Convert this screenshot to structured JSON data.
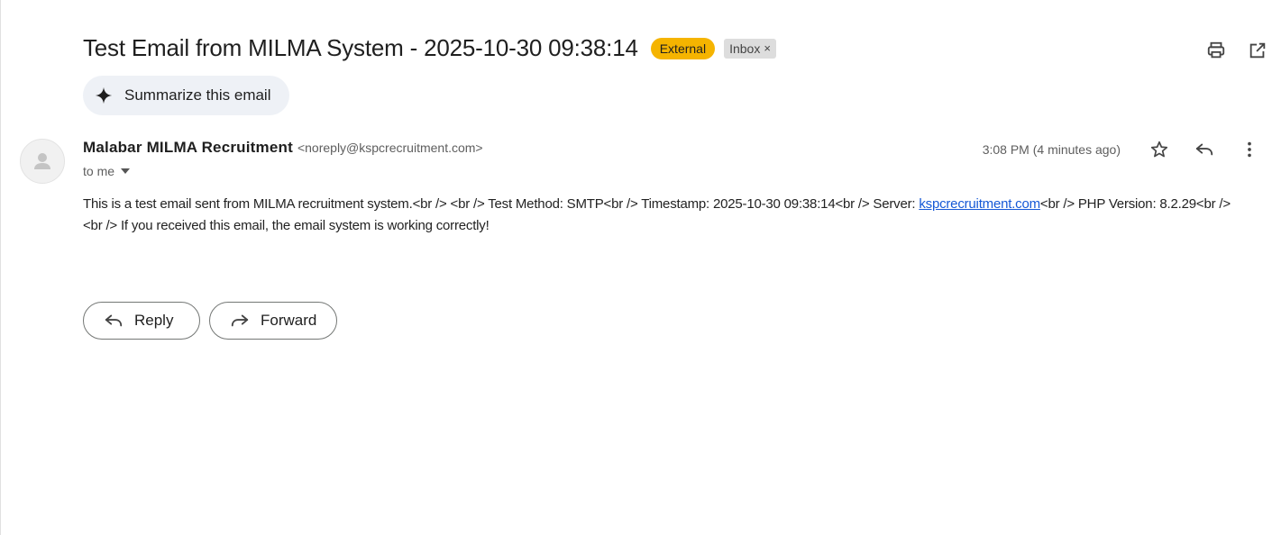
{
  "email": {
    "subject": "Test Email from MILMA System - 2025-10-30 09:38:14",
    "labels": {
      "external": "External",
      "inbox": "Inbox",
      "inbox_remove": "×"
    },
    "summarize_label": "Summarize this email",
    "sender": {
      "name": "Malabar MILMA Recruitment",
      "email": "<noreply@kspcrecruitment.com>"
    },
    "recipient": "to me",
    "time": "3:08 PM (4 minutes ago)",
    "body": {
      "part1": "This is a test email sent from MILMA recruitment system.<br /> <br /> Test Method: SMTP<br /> Timestamp: 2025-10-30 09:38:14<br /> Server: ",
      "link": "kspcrecruitment.com",
      "part2": "<br /> PHP Version: 8.2.29<br /> <br /> If you received this email, the email system is working correctly!"
    },
    "actions": {
      "reply": "Reply",
      "forward": "Forward"
    }
  },
  "colors": {
    "external_label": "#f5b400",
    "inbox_label": "#dddddd",
    "summarize_bg": "#eef1f6",
    "link": "#1558d6"
  },
  "icons": {
    "print": "print-icon",
    "open_new_window": "open-in-new-window-icon",
    "sparkle": "sparkle-icon",
    "avatar": "person-icon",
    "dropdown": "caret-down-icon",
    "star": "star-icon",
    "reply": "reply-icon",
    "more": "more-vert-icon",
    "forward": "forward-icon"
  }
}
